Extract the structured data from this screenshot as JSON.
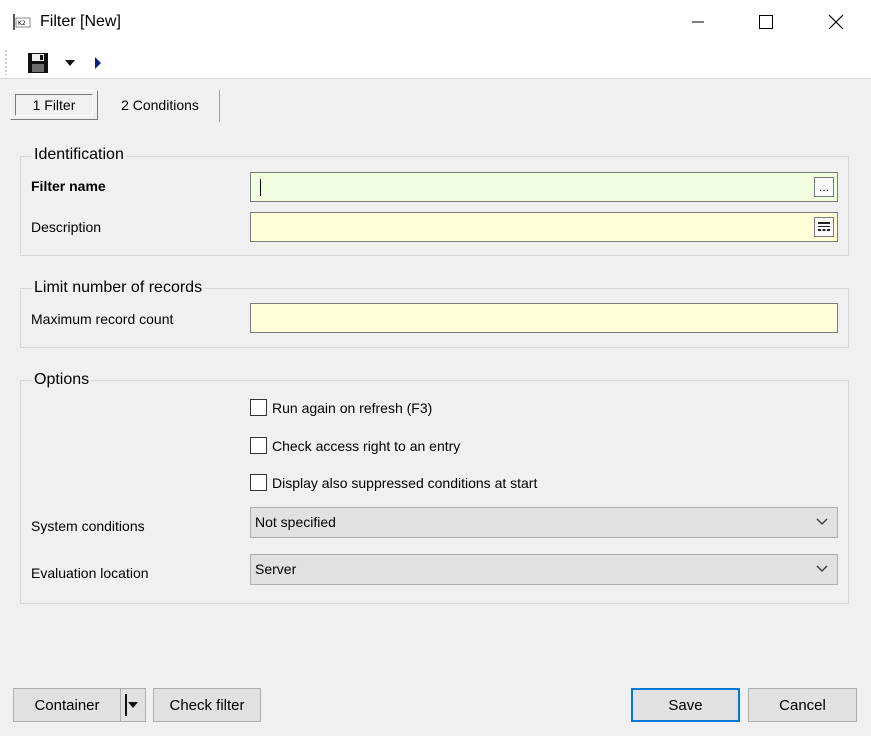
{
  "window": {
    "title": "Filter [New]",
    "icon": "k2-app-icon"
  },
  "toolbar": {
    "save_icon": "floppy-disk-icon",
    "dropdown_icon": "caret-down-icon",
    "run_icon": "play-arrow-icon"
  },
  "tabs": [
    {
      "label": "1 Filter",
      "active": true
    },
    {
      "label": "2 Conditions",
      "active": false
    }
  ],
  "identification": {
    "title": "Identification",
    "filter_name_label": "Filter name",
    "filter_name_value": "",
    "description_label": "Description",
    "description_value": "",
    "filter_name_button": "...",
    "description_button_icon": "list-icon"
  },
  "limit": {
    "title": "Limit number of records",
    "max_label": "Maximum record count",
    "max_value": ""
  },
  "options": {
    "title": "Options",
    "checkboxes": [
      {
        "label": "Run again on refresh (F3)",
        "checked": false
      },
      {
        "label": "Check access right to an entry",
        "checked": false
      },
      {
        "label": "Display also suppressed conditions at start",
        "checked": false
      }
    ],
    "system_conditions_label": "System conditions",
    "system_conditions_value": "Not specified",
    "evaluation_location_label": "Evaluation location",
    "evaluation_location_value": "Server"
  },
  "footer": {
    "container_label": "Container",
    "check_filter_label": "Check filter",
    "save_label": "Save",
    "cancel_label": "Cancel"
  },
  "colors": {
    "field_required": "#f2fde0",
    "field_normal": "#ffffd9",
    "focus_border": "#0078d7"
  }
}
